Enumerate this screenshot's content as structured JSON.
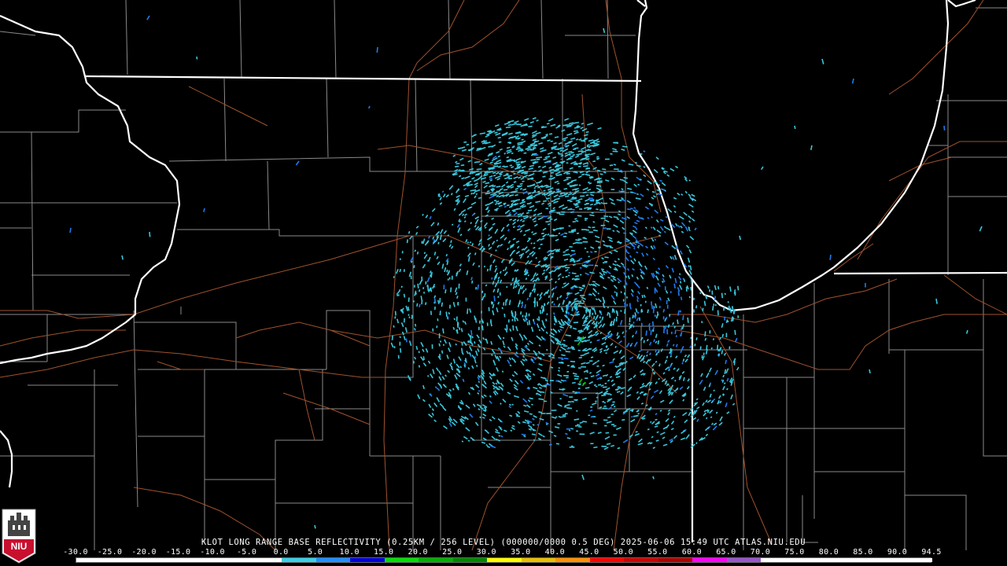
{
  "product": {
    "caption": "KLOT LONG RANGE BASE REFLECTIVITY (0.25KM / 256 LEVEL) (000000/0000 0.5 DEG) 2025-06-06 15:49 UTC  ATLAS.NIU.EDU",
    "radar_site": "KLOT",
    "product_name": "LONG RANGE BASE REFLECTIVITY",
    "resolution": "0.25KM / 256 LEVEL",
    "elevation": "0.5 DEG",
    "datetime": "2025-06-06 15:49 UTC",
    "source": "ATLAS.NIU.EDU"
  },
  "logo": {
    "text": "NIU",
    "color": "#c8102e"
  },
  "scale": {
    "labels": [
      "-30.0",
      "-25.0",
      "-20.0",
      "-15.0",
      "-10.0",
      "-5.0",
      "0.0",
      "5.0",
      "10.0",
      "15.0",
      "20.0",
      "25.0",
      "30.0",
      "35.0",
      "40.0",
      "45.0",
      "50.0",
      "55.0",
      "60.0",
      "65.0",
      "70.0",
      "75.0",
      "80.0",
      "85.0",
      "90.0",
      "94.5"
    ],
    "colors": [
      "#000000",
      "#000000",
      "#000000",
      "#000000",
      "#000000",
      "#000000",
      "#39d0e8",
      "#1e90ff",
      "#0000e0",
      "#00e000",
      "#00b000",
      "#008800",
      "#ffff00",
      "#e8c000",
      "#ff9000",
      "#ff0000",
      "#d00000",
      "#b00000",
      "#ff00ff",
      "#9955cc",
      "#ffffff",
      "#ffffff",
      "#ffffff",
      "#ffffff",
      "#ffffff"
    ]
  },
  "map_colors": {
    "state_border": "#ffffff",
    "county_border": "#8a8a8a",
    "highway": "#a0522d",
    "echo_light": "#39c8dc",
    "echo_medium": "#1e7cf0",
    "echo_strong": "#00c800"
  }
}
